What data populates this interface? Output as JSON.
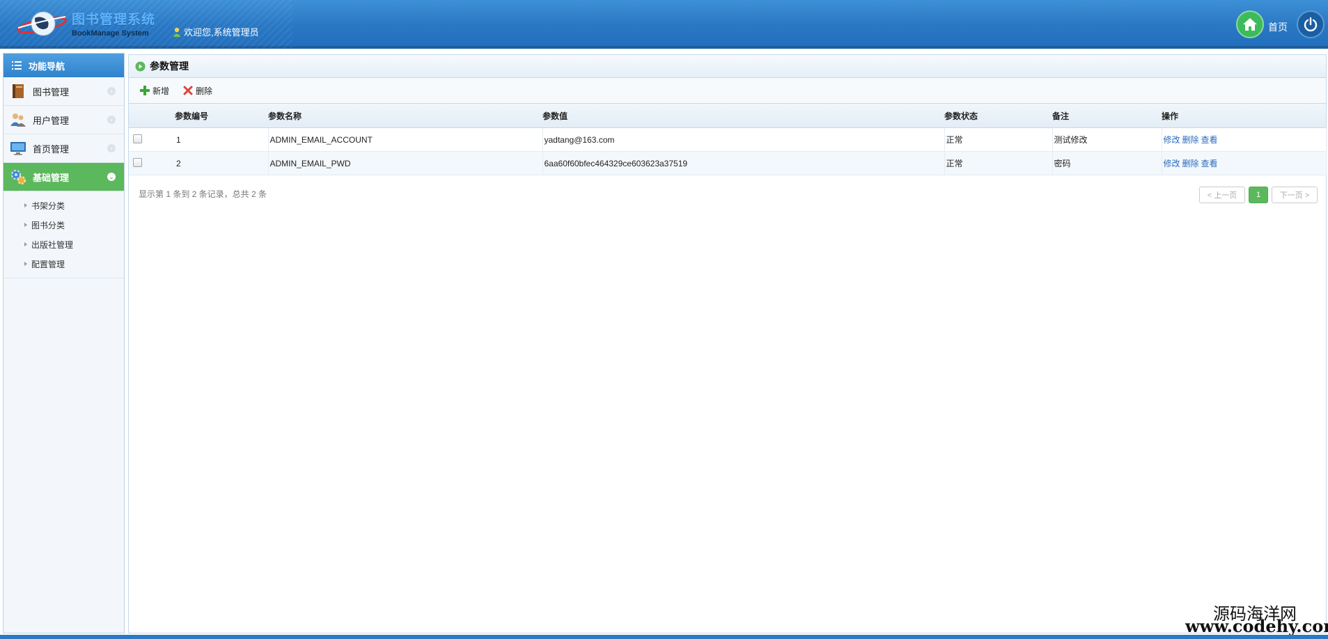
{
  "header": {
    "logo_title": "图书管理系统",
    "logo_subtitle": "BookManage System",
    "welcome": "欢迎您,系统管理员",
    "home_label": "首页",
    "home_icon": "home-icon",
    "power_icon": "power-icon"
  },
  "sidebar": {
    "title": "功能导航",
    "items": [
      {
        "label": "图书管理",
        "icon": "book-icon",
        "active": false
      },
      {
        "label": "用户管理",
        "icon": "users-icon",
        "active": false
      },
      {
        "label": "首页管理",
        "icon": "monitor-icon",
        "active": false
      },
      {
        "label": "基础管理",
        "icon": "gears-icon",
        "active": true
      }
    ],
    "submenu": [
      "书架分类",
      "图书分类",
      "出版社管理",
      "配置管理"
    ]
  },
  "main": {
    "title": "参数管理",
    "toolbar": {
      "add_label": "新增",
      "delete_label": "删除"
    },
    "table": {
      "columns": [
        "参数编号",
        "参数名称",
        "参数值",
        "参数状态",
        "备注",
        "操作"
      ],
      "rows": [
        {
          "id": "1",
          "name": "ADMIN_EMAIL_ACCOUNT",
          "value": "yadtang@163.com",
          "status": "正常",
          "remark": "测试修改"
        },
        {
          "id": "2",
          "name": "ADMIN_EMAIL_PWD",
          "value": "6aa60f60bfec464329ce603623a37519",
          "status": "正常",
          "remark": "密码"
        }
      ],
      "actions": {
        "edit": "修改",
        "delete": "删除",
        "view": "查看"
      }
    },
    "info": "显示第 1 条到 2 条记录，总共 2 条",
    "pager": {
      "prev": "< 上一页",
      "current": "1",
      "next": "下一页 >"
    }
  },
  "watermark": {
    "line1": "源码海洋网",
    "line2": "www.codehy.com"
  },
  "colors": {
    "header_blue": "#2a78c4",
    "active_green": "#5cb85c",
    "status_blue": "#1a3d9e"
  }
}
